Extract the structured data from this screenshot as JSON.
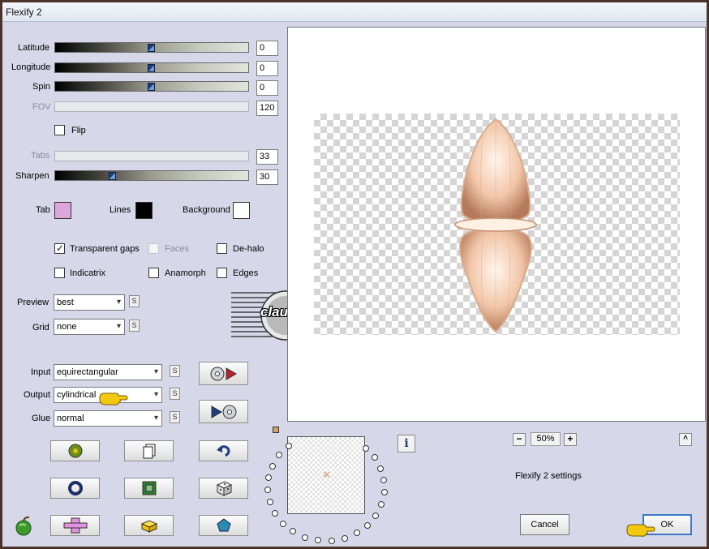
{
  "window": {
    "title": "Flexify 2"
  },
  "sliders": [
    {
      "label": "Latitude",
      "value": "0",
      "fill": 0.5,
      "disabled": false
    },
    {
      "label": "Longitude",
      "value": "0",
      "fill": 0.5,
      "disabled": false
    },
    {
      "label": "Spin",
      "value": "0",
      "fill": 0.5,
      "disabled": false
    },
    {
      "label": "FOV",
      "value": "120",
      "fill": null,
      "disabled": true
    },
    {
      "label": "Tabs",
      "value": "33",
      "fill": null,
      "disabled": true
    },
    {
      "label": "Sharpen",
      "value": "30",
      "fill": 0.3,
      "disabled": false
    }
  ],
  "flip": {
    "label": "Flip",
    "checked": false
  },
  "colors": {
    "tab": {
      "label": "Tab",
      "value": "#dca6dc"
    },
    "lines": {
      "label": "Lines",
      "value": "#000000"
    },
    "background": {
      "label": "Background",
      "value": "#ffffff"
    }
  },
  "options": {
    "transparent_gaps": {
      "label": "Transparent gaps",
      "checked": true
    },
    "faces": {
      "label": "Faces",
      "checked": false,
      "disabled": true
    },
    "de_halo": {
      "label": "De-halo",
      "checked": false
    },
    "indicatrix": {
      "label": "Indicatrix",
      "checked": false
    },
    "anamorph": {
      "label": "Anamorph",
      "checked": false
    },
    "edges": {
      "label": "Edges",
      "checked": false
    }
  },
  "preview": {
    "label": "Preview",
    "value": "best"
  },
  "grid": {
    "label": "Grid",
    "value": "none"
  },
  "input": {
    "label": "Input",
    "value": "equirectangular"
  },
  "output": {
    "label": "Output",
    "value": "cylindrical"
  },
  "glue": {
    "label": "Glue",
    "value": "normal"
  },
  "s_button_label": "S",
  "watermark": {
    "text": "claudia"
  },
  "zoom": {
    "minus": "−",
    "value": "50%",
    "plus": "+"
  },
  "collapse_label": "^",
  "info_label": "i",
  "settings_name": "Flexify 2 settings",
  "buttons": {
    "cancel": "Cancel",
    "ok": "OK"
  },
  "accent_colors": {
    "window_border": "#4b3329",
    "default_button_border": "#3b78c8",
    "hand_pointer": "#f2c90f"
  }
}
